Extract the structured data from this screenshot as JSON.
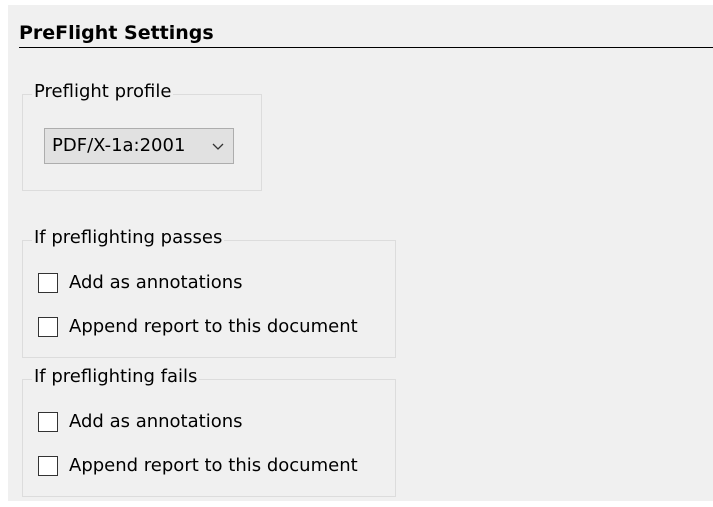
{
  "section": {
    "title": "PreFlight Settings"
  },
  "profile_group": {
    "title": "Preflight profile",
    "select_value": "PDF/X-1a:2001"
  },
  "passes_group": {
    "title": "If preflighting passes",
    "options": [
      {
        "label": "Add as annotations",
        "checked": false
      },
      {
        "label": "Append report to this document",
        "checked": false
      }
    ]
  },
  "fails_group": {
    "title": "If preflighting fails",
    "options": [
      {
        "label": "Add as annotations",
        "checked": false
      },
      {
        "label": "Append report to this document",
        "checked": false
      }
    ]
  },
  "icons": {
    "select_arrow": "chevron-down-icon"
  },
  "colors": {
    "panel_background": "#f0f0f0",
    "group_border": "#dcdcdc",
    "select_background": "#e1e1e1",
    "select_border": "#adadad"
  }
}
